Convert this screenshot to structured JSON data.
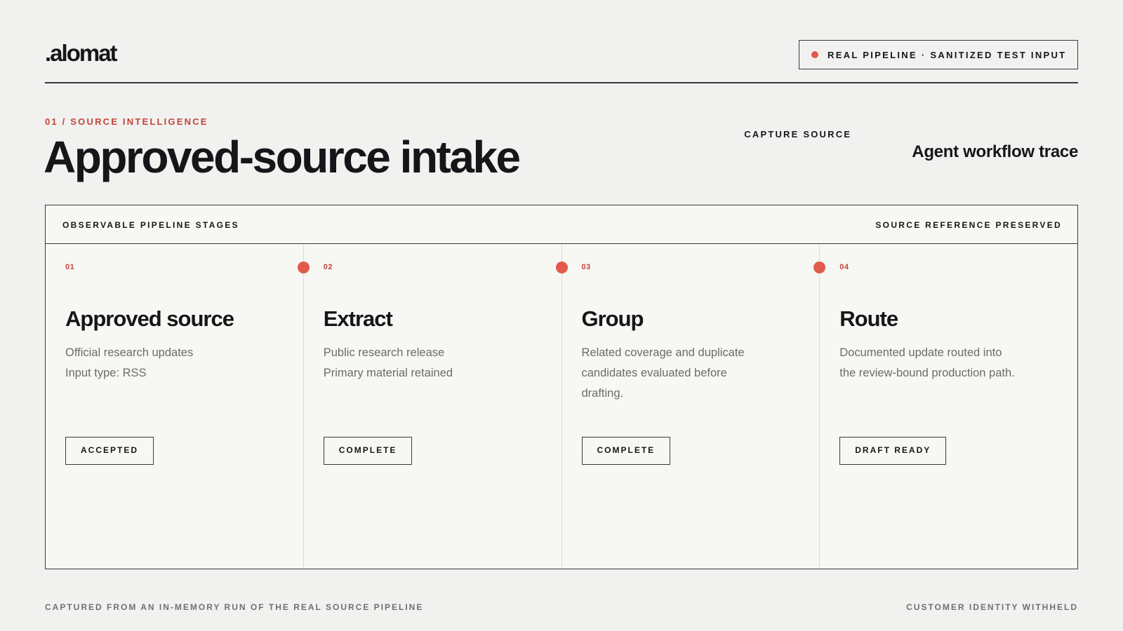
{
  "brand": {
    "logo_text": ".alomat"
  },
  "status": {
    "label": "REAL PIPELINE · SANITIZED TEST INPUT",
    "dot_color": "#e15a4c"
  },
  "section": {
    "eyebrow": "01 / SOURCE INTELLIGENCE",
    "title": "Approved-source intake"
  },
  "capture": {
    "label": "CAPTURE SOURCE",
    "value": "Agent workflow trace"
  },
  "panel": {
    "header_left": "OBSERVABLE PIPELINE STAGES",
    "header_right": "SOURCE REFERENCE PRESERVED",
    "stages": [
      {
        "number": "01",
        "title": "Approved source",
        "lines": [
          "Official research updates",
          "Input type: RSS"
        ],
        "badge": "ACCEPTED"
      },
      {
        "number": "02",
        "title": "Extract",
        "lines": [
          "Public research release",
          "Primary material retained"
        ],
        "badge": "COMPLETE"
      },
      {
        "number": "03",
        "title": "Group",
        "lines": [
          "Related coverage and duplicate",
          "candidates evaluated before",
          "drafting."
        ],
        "badge": "COMPLETE"
      },
      {
        "number": "04",
        "title": "Route",
        "lines": [
          "Documented update routed into",
          "the review-bound production path."
        ],
        "badge": "DRAFT READY"
      }
    ]
  },
  "footer": {
    "left": "CAPTURED FROM AN IN-MEMORY RUN OF THE REAL SOURCE PIPELINE",
    "right": "CUSTOMER IDENTITY WITHHELD"
  },
  "colors": {
    "accent": "#e15a4c",
    "accent_text": "#c2453a",
    "background": "#f1f1ef",
    "panel": "#f7f7f3",
    "ink": "#16161a"
  }
}
